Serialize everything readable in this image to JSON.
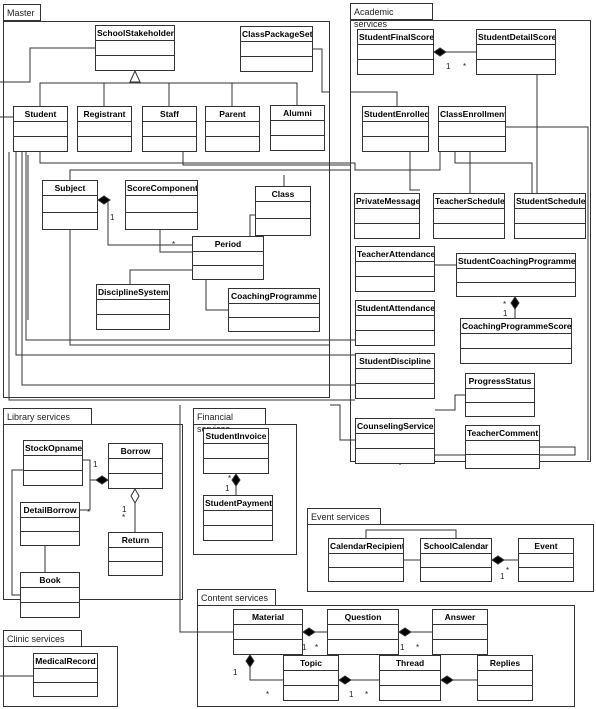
{
  "packages": [
    {
      "label": "Master"
    },
    {
      "label": "Academic services"
    },
    {
      "label": "Library services"
    },
    {
      "label": "Financial services"
    },
    {
      "label": "Event services"
    },
    {
      "label": "Content services"
    },
    {
      "label": "Clinic services"
    }
  ],
  "classes": [
    "SchoolStakeholder",
    "ClassPackageSet",
    "Student",
    "Registrant",
    "Staff",
    "Parent",
    "Alumni",
    "Subject",
    "ScoreComponent",
    "Class",
    "Period",
    "DisciplineSystem",
    "CoachingProgramme",
    "StudentFinalScore",
    "StudentDetailScore",
    "StudentEnrolled",
    "ClassEnrollment",
    "PrivateMessage",
    "TeacherSchedule",
    "StudentSchedule",
    "TeacherAttendance",
    "StudentCoachingProgramme",
    "StudentAttendance",
    "CoachingProgrammeScore",
    "StudentDiscipline",
    "ProgressStatus",
    "CounselingService",
    "TeacherComment",
    "StockOpname",
    "Borrow",
    "DetailBorrow",
    "Return",
    "Book",
    "StudentInvoice",
    "StudentPayment",
    "CalendarRecipient",
    "SchoolCalendar",
    "Event",
    "Material",
    "Question",
    "Answer",
    "Topic",
    "Thread",
    "Replies",
    "MedicalRecord"
  ],
  "multiplicities": [
    "1",
    "*",
    "1",
    "*",
    "*",
    "1",
    "1",
    "*",
    "1",
    "*",
    "1",
    "*",
    "1",
    "*",
    "1",
    "*",
    "1",
    "*",
    "1",
    "*",
    "1",
    "*"
  ],
  "colors": {
    "line": "#333333",
    "background": "#ffffff"
  }
}
